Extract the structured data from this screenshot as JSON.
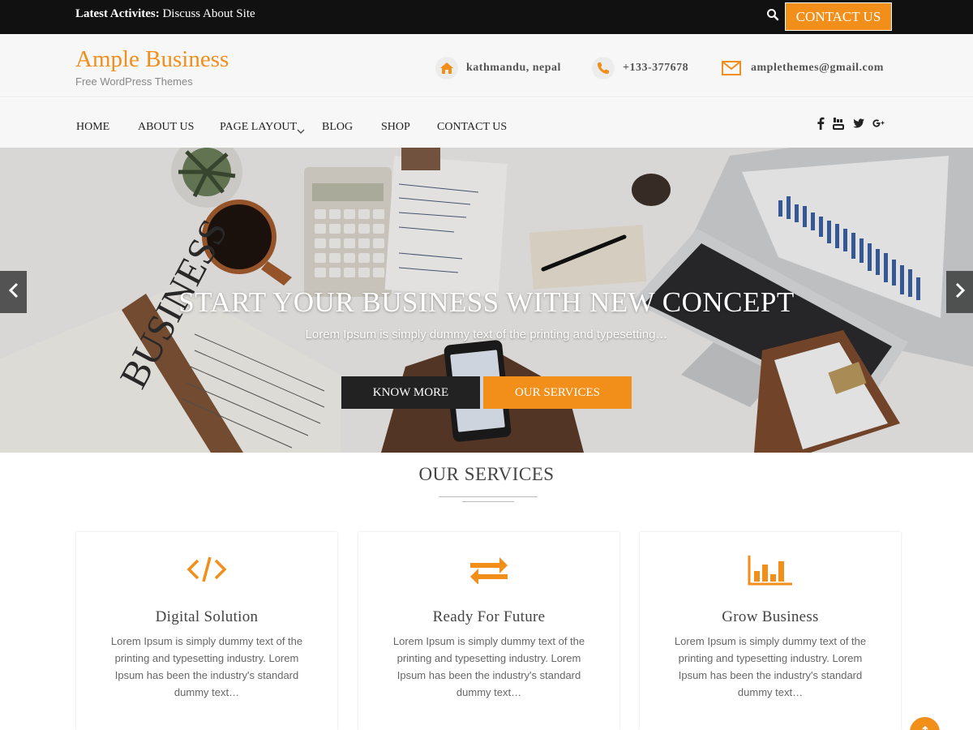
{
  "topbar": {
    "latest_label": "Latest Activites:",
    "latest_text": "Discuss About Site",
    "search_icon": "search-icon",
    "contact_button": "CONTACT US"
  },
  "header": {
    "brand": "Ample Business",
    "tagline": "Free WordPress Themes",
    "location": "kathmandu, nepal",
    "phone": "+133-377678",
    "email": "amplethemes@gmail.com"
  },
  "nav": {
    "items": [
      "HOME",
      "ABOUT US",
      "PAGE LAYOUT",
      "BLOG",
      "SHOP",
      "CONTACT US"
    ],
    "social": [
      "facebook-icon",
      "youtube-icon",
      "twitter-icon",
      "google-plus-icon"
    ]
  },
  "hero": {
    "title": "START YOUR BUSINESS WITH NEW CONCEPT",
    "subtitle": "Lorem Ipsum is simply dummy text of the printing and typesetting…",
    "know_more": "KNOW MORE",
    "our_services": "OUR SERVICES"
  },
  "services": {
    "heading": "OUR SERVICES",
    "cards": [
      {
        "icon": "code-icon",
        "title": "Digital Solution",
        "text": "Lorem Ipsum is simply dummy text of the printing and typesetting industry. Lorem Ipsum has been the industry's standard dummy text…"
      },
      {
        "icon": "exchange-icon",
        "title": "Ready For Future",
        "text": "Lorem Ipsum is simply dummy text of the printing and typesetting industry. Lorem Ipsum has been the industry's standard dummy text…"
      },
      {
        "icon": "bar-chart-icon",
        "title": "Grow Business",
        "text": "Lorem Ipsum is simply dummy text of the printing and typesetting industry. Lorem Ipsum has been the industry's standard dummy text…"
      }
    ]
  },
  "colors": {
    "accent": "#f28e1a",
    "topbar": "#111111",
    "dark_button": "#222222"
  }
}
